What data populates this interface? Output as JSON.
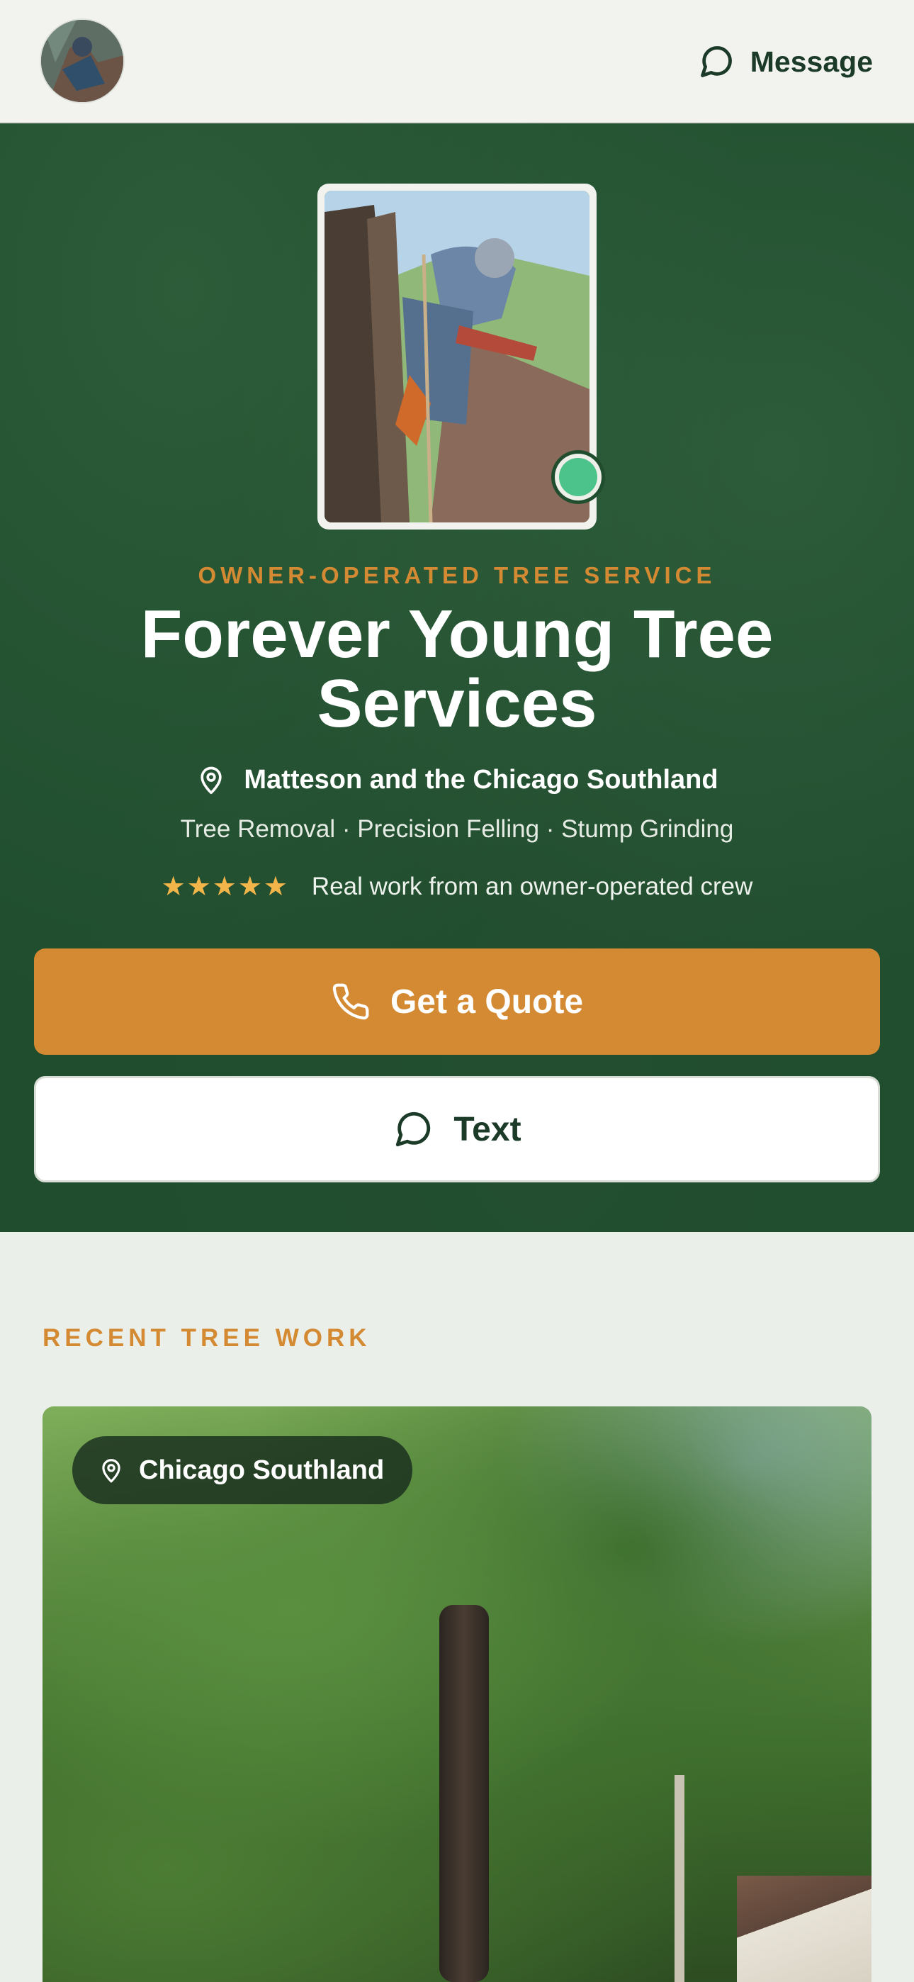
{
  "header": {
    "message_label": "Message"
  },
  "hero": {
    "eyebrow": "OWNER-OPERATED TREE SERVICE",
    "title": "Forever Young Tree Services",
    "location": "Matteson and the Chicago Southland",
    "services": "Tree Removal · Precision Felling · Stump Grinding",
    "stars": "★★★★★",
    "rating_text": "Real work from an owner-operated crew",
    "quote_button": "Get a Quote",
    "text_button": "Text"
  },
  "recent_work": {
    "section_label": "RECENT TREE WORK",
    "card_location": "Chicago Southland"
  },
  "colors": {
    "hero_green": "#1F4D2E",
    "accent_orange": "#D48A32",
    "status_green": "#4CC38A"
  },
  "icons": [
    "chat-bubble-icon",
    "map-pin-icon",
    "phone-icon",
    "star-icon"
  ]
}
